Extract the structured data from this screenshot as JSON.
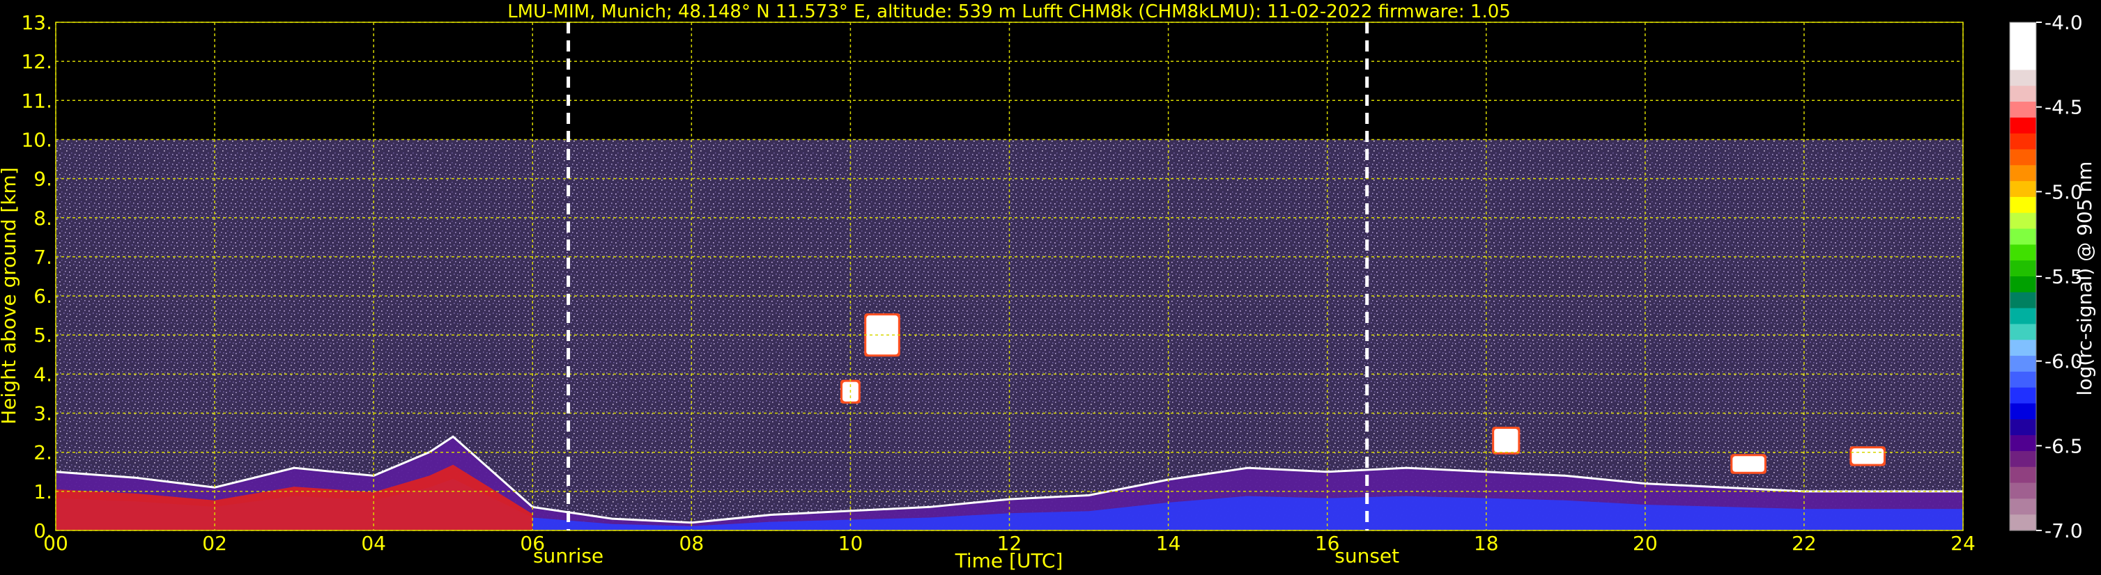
{
  "chart_data": {
    "type": "heatmap",
    "title": "LMU-MIM, Munich; 48.148° N 11.573° E, altitude: 539 m    Lufft CHM8k (CHM8kLMU): 11-02-2022    firmware: 1.05",
    "xlabel": "Time [UTC]",
    "ylabel": "Height above ground [km]",
    "xlim": [
      0,
      24
    ],
    "ylim": [
      0,
      13
    ],
    "x_ticks": [
      "00",
      "02",
      "04",
      "06",
      "08",
      "10",
      "12",
      "14",
      "16",
      "18",
      "20",
      "22",
      "24"
    ],
    "y_ticks": [
      "0.",
      "1.",
      "2.",
      "3.",
      "4.",
      "5.",
      "6.",
      "7.",
      "8.",
      "9.",
      "10.",
      "11.",
      "12.",
      "13."
    ],
    "grid": true,
    "colorbar": {
      "label": "log(rc-signal) @ 905 nm",
      "range": [
        -7.0,
        -4.0
      ],
      "ticks": [
        "-4.0",
        "-4.5",
        "-5.0",
        "-5.5",
        "-6.0",
        "-6.5",
        "-7.0"
      ],
      "colors": [
        "#ffffff",
        "#ffffff",
        "#ffffff",
        "#e8d8d8",
        "#f0c0c0",
        "#ff8080",
        "#ff0000",
        "#ff3000",
        "#ff6000",
        "#ff9000",
        "#ffc000",
        "#ffff00",
        "#c0ff40",
        "#80ff40",
        "#40e000",
        "#20c000",
        "#00a000",
        "#008060",
        "#00b0a0",
        "#40d0c0",
        "#80c0ff",
        "#6090ff",
        "#4060ff",
        "#2030ff",
        "#0000e0",
        "#2000a0",
        "#500090",
        "#702080",
        "#904080",
        "#a06090",
        "#b080a0",
        "#c0a0b0"
      ]
    },
    "markers": [
      {
        "x": 6.45,
        "label": "sunrise"
      },
      {
        "x": 16.5,
        "label": "sunset"
      }
    ],
    "noise_top_km": 10,
    "aerosol_layer_top_km": [
      [
        0,
        1.5
      ],
      [
        1,
        1.35
      ],
      [
        2,
        1.1
      ],
      [
        3,
        1.6
      ],
      [
        4,
        1.4
      ],
      [
        4.7,
        2.0
      ],
      [
        5,
        2.4
      ],
      [
        5.5,
        1.5
      ],
      [
        6,
        0.6
      ],
      [
        7,
        0.3
      ],
      [
        8,
        0.2
      ],
      [
        9,
        0.4
      ],
      [
        10,
        0.5
      ],
      [
        11,
        0.6
      ],
      [
        12,
        0.8
      ],
      [
        13,
        0.9
      ],
      [
        14,
        1.3
      ],
      [
        15,
        1.6
      ],
      [
        16,
        1.5
      ],
      [
        17,
        1.6
      ],
      [
        18,
        1.5
      ],
      [
        19,
        1.4
      ],
      [
        20,
        1.2
      ],
      [
        21,
        1.1
      ],
      [
        22,
        1.0
      ],
      [
        23,
        1.0
      ],
      [
        24,
        1.0
      ]
    ],
    "clouds": [
      {
        "t": [
          9.9,
          10.1
        ],
        "h": [
          3.3,
          3.8
        ]
      },
      {
        "t": [
          10.2,
          10.6
        ],
        "h": [
          4.5,
          5.5
        ]
      },
      {
        "t": [
          18.1,
          18.4
        ],
        "h": [
          2.0,
          2.6
        ]
      },
      {
        "t": [
          21.1,
          21.5
        ],
        "h": [
          1.5,
          1.9
        ]
      },
      {
        "t": [
          22.6,
          23.0
        ],
        "h": [
          1.7,
          2.1
        ]
      }
    ]
  }
}
